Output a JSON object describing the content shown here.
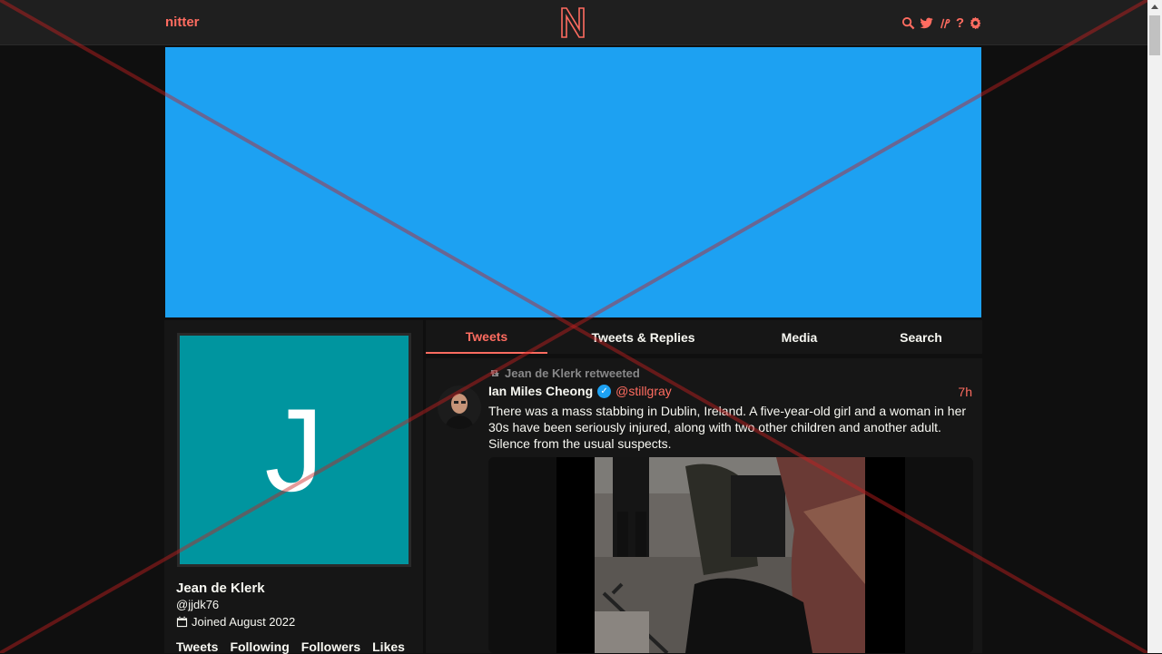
{
  "header": {
    "brand": "nitter",
    "logo_letter": "N",
    "icons": [
      "search-icon",
      "twitter-icon",
      "rss-icon",
      "help-icon",
      "gear-icon"
    ],
    "help_glyph": "?"
  },
  "banner": {
    "color": "#1da1f2"
  },
  "profile": {
    "avatar_letter": "J",
    "avatar_color": "#00959f",
    "fullname": "Jean de Klerk",
    "username": "@jjdk76",
    "joined": "Joined August 2022",
    "stats": [
      "Tweets",
      "Following",
      "Followers",
      "Likes"
    ]
  },
  "tabs": [
    {
      "label": "Tweets",
      "active": true
    },
    {
      "label": "Tweets & Replies",
      "active": false
    },
    {
      "label": "Media",
      "active": false
    },
    {
      "label": "Search",
      "active": false
    }
  ],
  "tweet": {
    "retweet_label": "Jean de Klerk retweeted",
    "name": "Ian Miles Cheong",
    "handle": "@stillgray",
    "time": "7h",
    "text": "There was a mass stabbing in Dublin, Ireland. A five-year-old girl and a woman in her 30s have been seriously injured, along with two other children and another adult. Silence from the usual suspects."
  },
  "colors": {
    "accent": "#ff6c60",
    "background": "#0f0f0f",
    "panel": "#161616"
  }
}
